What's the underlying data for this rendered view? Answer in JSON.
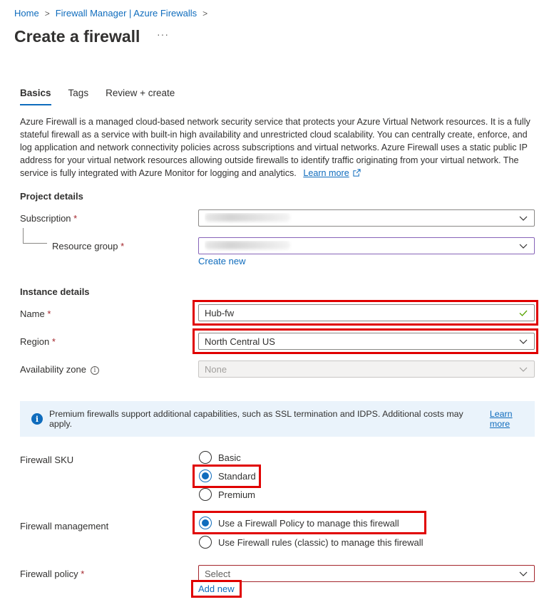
{
  "breadcrumb": {
    "items": [
      "Home",
      "Firewall Manager | Azure Firewalls"
    ],
    "separator": ">"
  },
  "page": {
    "title": "Create a firewall",
    "more": "···"
  },
  "tabs": [
    {
      "label": "Basics",
      "active": true
    },
    {
      "label": "Tags",
      "active": false
    },
    {
      "label": "Review + create",
      "active": false
    }
  ],
  "description": {
    "text": "Azure Firewall is a managed cloud-based network security service that protects your Azure Virtual Network resources. It is a fully stateful firewall as a service with built-in high availability and unrestricted cloud scalability. You can centrally create, enforce, and log application and network connectivity policies across subscriptions and virtual networks. Azure Firewall uses a static public IP address for your virtual network resources allowing outside firewalls to identify traffic originating from your virtual network. The service is fully integrated with Azure Monitor for logging and analytics.",
    "learn_more": "Learn more"
  },
  "project_details": {
    "heading": "Project details",
    "subscription_label": "Subscription",
    "resource_group_label": "Resource group",
    "create_new": "Create new"
  },
  "instance_details": {
    "heading": "Instance details",
    "name_label": "Name",
    "name_value": "Hub-fw",
    "region_label": "Region",
    "region_value": "North Central US",
    "zone_label": "Availability zone",
    "zone_value": "None"
  },
  "info_banner": {
    "text": "Premium firewalls support additional capabilities, such as SSL termination and IDPS. Additional costs may apply.",
    "learn_more": "Learn more"
  },
  "sku": {
    "label": "Firewall SKU",
    "options": [
      "Basic",
      "Standard",
      "Premium"
    ],
    "selected": "Standard"
  },
  "management": {
    "label": "Firewall management",
    "options": [
      "Use a Firewall Policy to manage this firewall",
      "Use Firewall rules (classic) to manage this firewall"
    ],
    "selected": "Use a Firewall Policy to manage this firewall"
  },
  "policy": {
    "label": "Firewall policy",
    "placeholder": "Select",
    "add_new": "Add new"
  },
  "required_marker": "*",
  "colors": {
    "accent": "#0f6cbd",
    "highlight": "#e00000",
    "required": "#a4262c",
    "info_bg": "#eaf3fb"
  }
}
